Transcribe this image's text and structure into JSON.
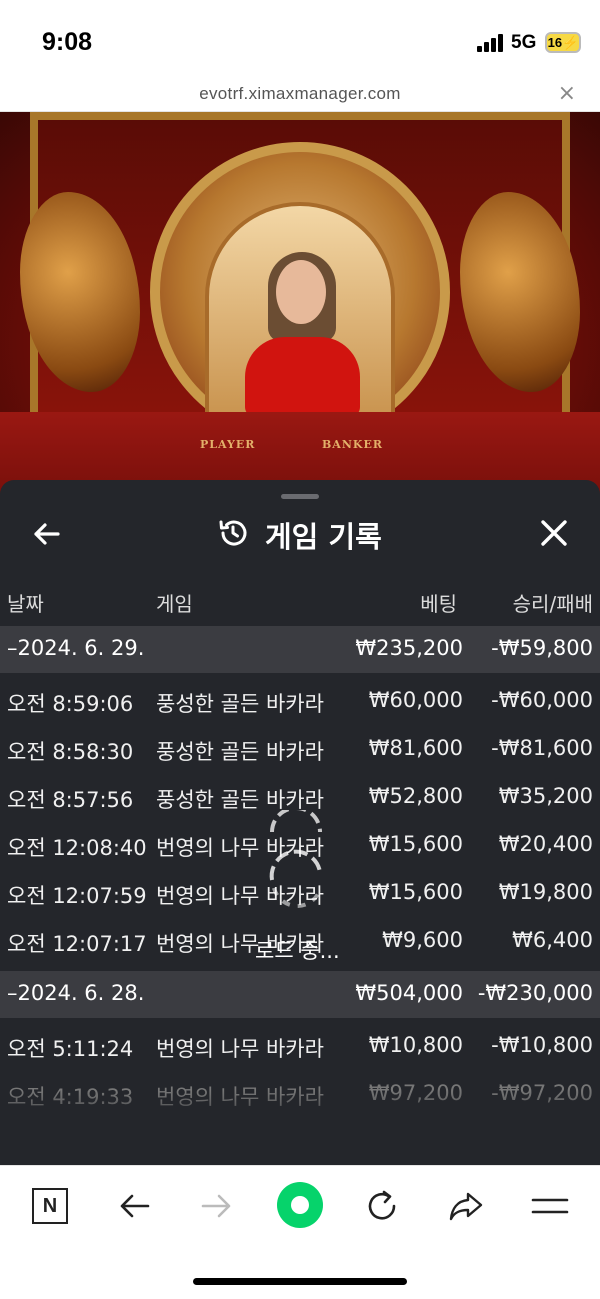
{
  "status_bar": {
    "time": "9:08",
    "network": "5G",
    "battery": "16⚡"
  },
  "browser": {
    "url": "evotrf.ximaxmanager.com",
    "close_label": "×"
  },
  "video": {
    "table_labels": [
      "PLAYER",
      "BANKER"
    ]
  },
  "panel": {
    "title": "게임 기록",
    "columns": {
      "date": "날짜",
      "game": "게임",
      "bet": "베팅",
      "winloss": "승리/패배"
    },
    "loading_text": "로드 중..."
  },
  "history": [
    {
      "date": "–2024. 6. 29.",
      "bet_total": "₩235,200",
      "winloss_total": "-₩59,800",
      "records": [
        {
          "time": "오전 8:59:06",
          "game": "풍성한 골든 바카라",
          "bet": "₩60,000",
          "winloss": "-₩60,000"
        },
        {
          "time": "오전 8:58:30",
          "game": "풍성한 골든 바카라",
          "bet": "₩81,600",
          "winloss": "-₩81,600"
        },
        {
          "time": "오전 8:57:56",
          "game": "풍성한 골든 바카라",
          "bet": "₩52,800",
          "winloss": "₩35,200"
        },
        {
          "time": "오전 12:08:40",
          "game": "번영의 나무 바카라",
          "bet": "₩15,600",
          "winloss": "₩20,400"
        },
        {
          "time": "오전 12:07:59",
          "game": "번영의 나무 바카라",
          "bet": "₩15,600",
          "winloss": "₩19,800"
        },
        {
          "time": "오전 12:07:17",
          "game": "번영의 나무 바카라",
          "bet": "₩9,600",
          "winloss": "₩6,400"
        }
      ]
    },
    {
      "date": "–2024. 6. 28.",
      "bet_total": "₩504,000",
      "winloss_total": "-₩230,000",
      "records": [
        {
          "time": "오전 5:11:24",
          "game": "번영의 나무 바카라",
          "bet": "₩10,800",
          "winloss": "-₩10,800"
        },
        {
          "time": "오전 4:19:33",
          "game": "번영의 나무 바카라",
          "bet": "₩97,200",
          "winloss": "-₩97,200"
        }
      ]
    }
  ],
  "icons": {
    "back": "arrow-left-icon",
    "history": "history-icon",
    "close": "close-icon",
    "nav": [
      "naver-n-icon",
      "back-arrow-icon",
      "forward-arrow-icon",
      "green-dot-icon",
      "refresh-icon",
      "share-icon",
      "menu-icon"
    ]
  },
  "colors": {
    "panel_bg": "#24262b",
    "date_row_bg": "#3b3c41",
    "accent_green": "#06d36b"
  }
}
